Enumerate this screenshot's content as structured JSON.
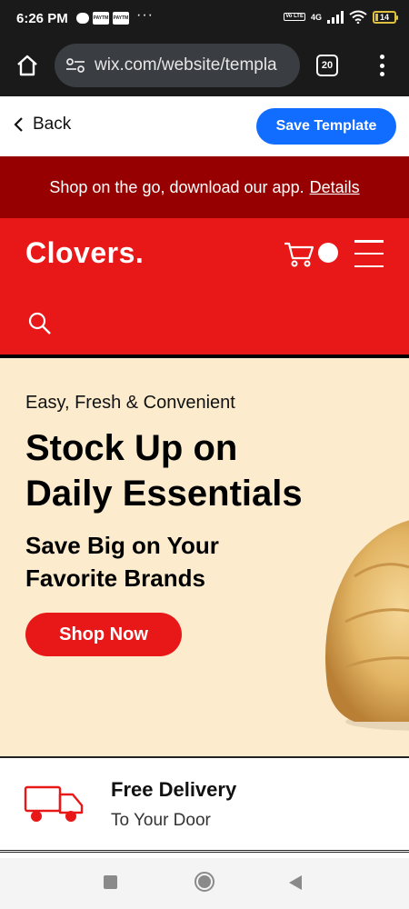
{
  "status_bar": {
    "time": "6:26 PM",
    "notif_label_1": "PAYTM",
    "notif_label_2": "PAYTM",
    "more": "···",
    "volte": "Vo LTE",
    "network": "4G",
    "battery": "14",
    "battery_level_percent": 14
  },
  "browser": {
    "url": "wix.com/website/templa",
    "tab_count": "20"
  },
  "editor_bar": {
    "back_label": "Back",
    "save_label": "Save Template",
    "accent_color": "#116dff"
  },
  "announcement": {
    "text": "Shop on the go, download our app.",
    "link": "Details"
  },
  "site_header": {
    "logo": "Clovers.",
    "brand_color": "#e91818"
  },
  "hero": {
    "tagline": "Easy, Fresh & Convenient",
    "title_line1": "Stock Up on",
    "title_line2": "Daily Essentials",
    "subtitle_line1": "Save Big on Your",
    "subtitle_line2": "Favorite Brands",
    "cta": "Shop Now",
    "background_color": "#fcebcc"
  },
  "feature": {
    "title": "Free Delivery",
    "subtitle": "To Your Door"
  },
  "icons": {
    "home": "home-icon",
    "site_settings": "site-settings-icon",
    "menu": "more-vert-icon",
    "back": "chevron-left-icon",
    "cart": "cart-icon",
    "hamburger": "hamburger-menu-icon",
    "search": "search-icon",
    "truck": "truck-icon"
  }
}
